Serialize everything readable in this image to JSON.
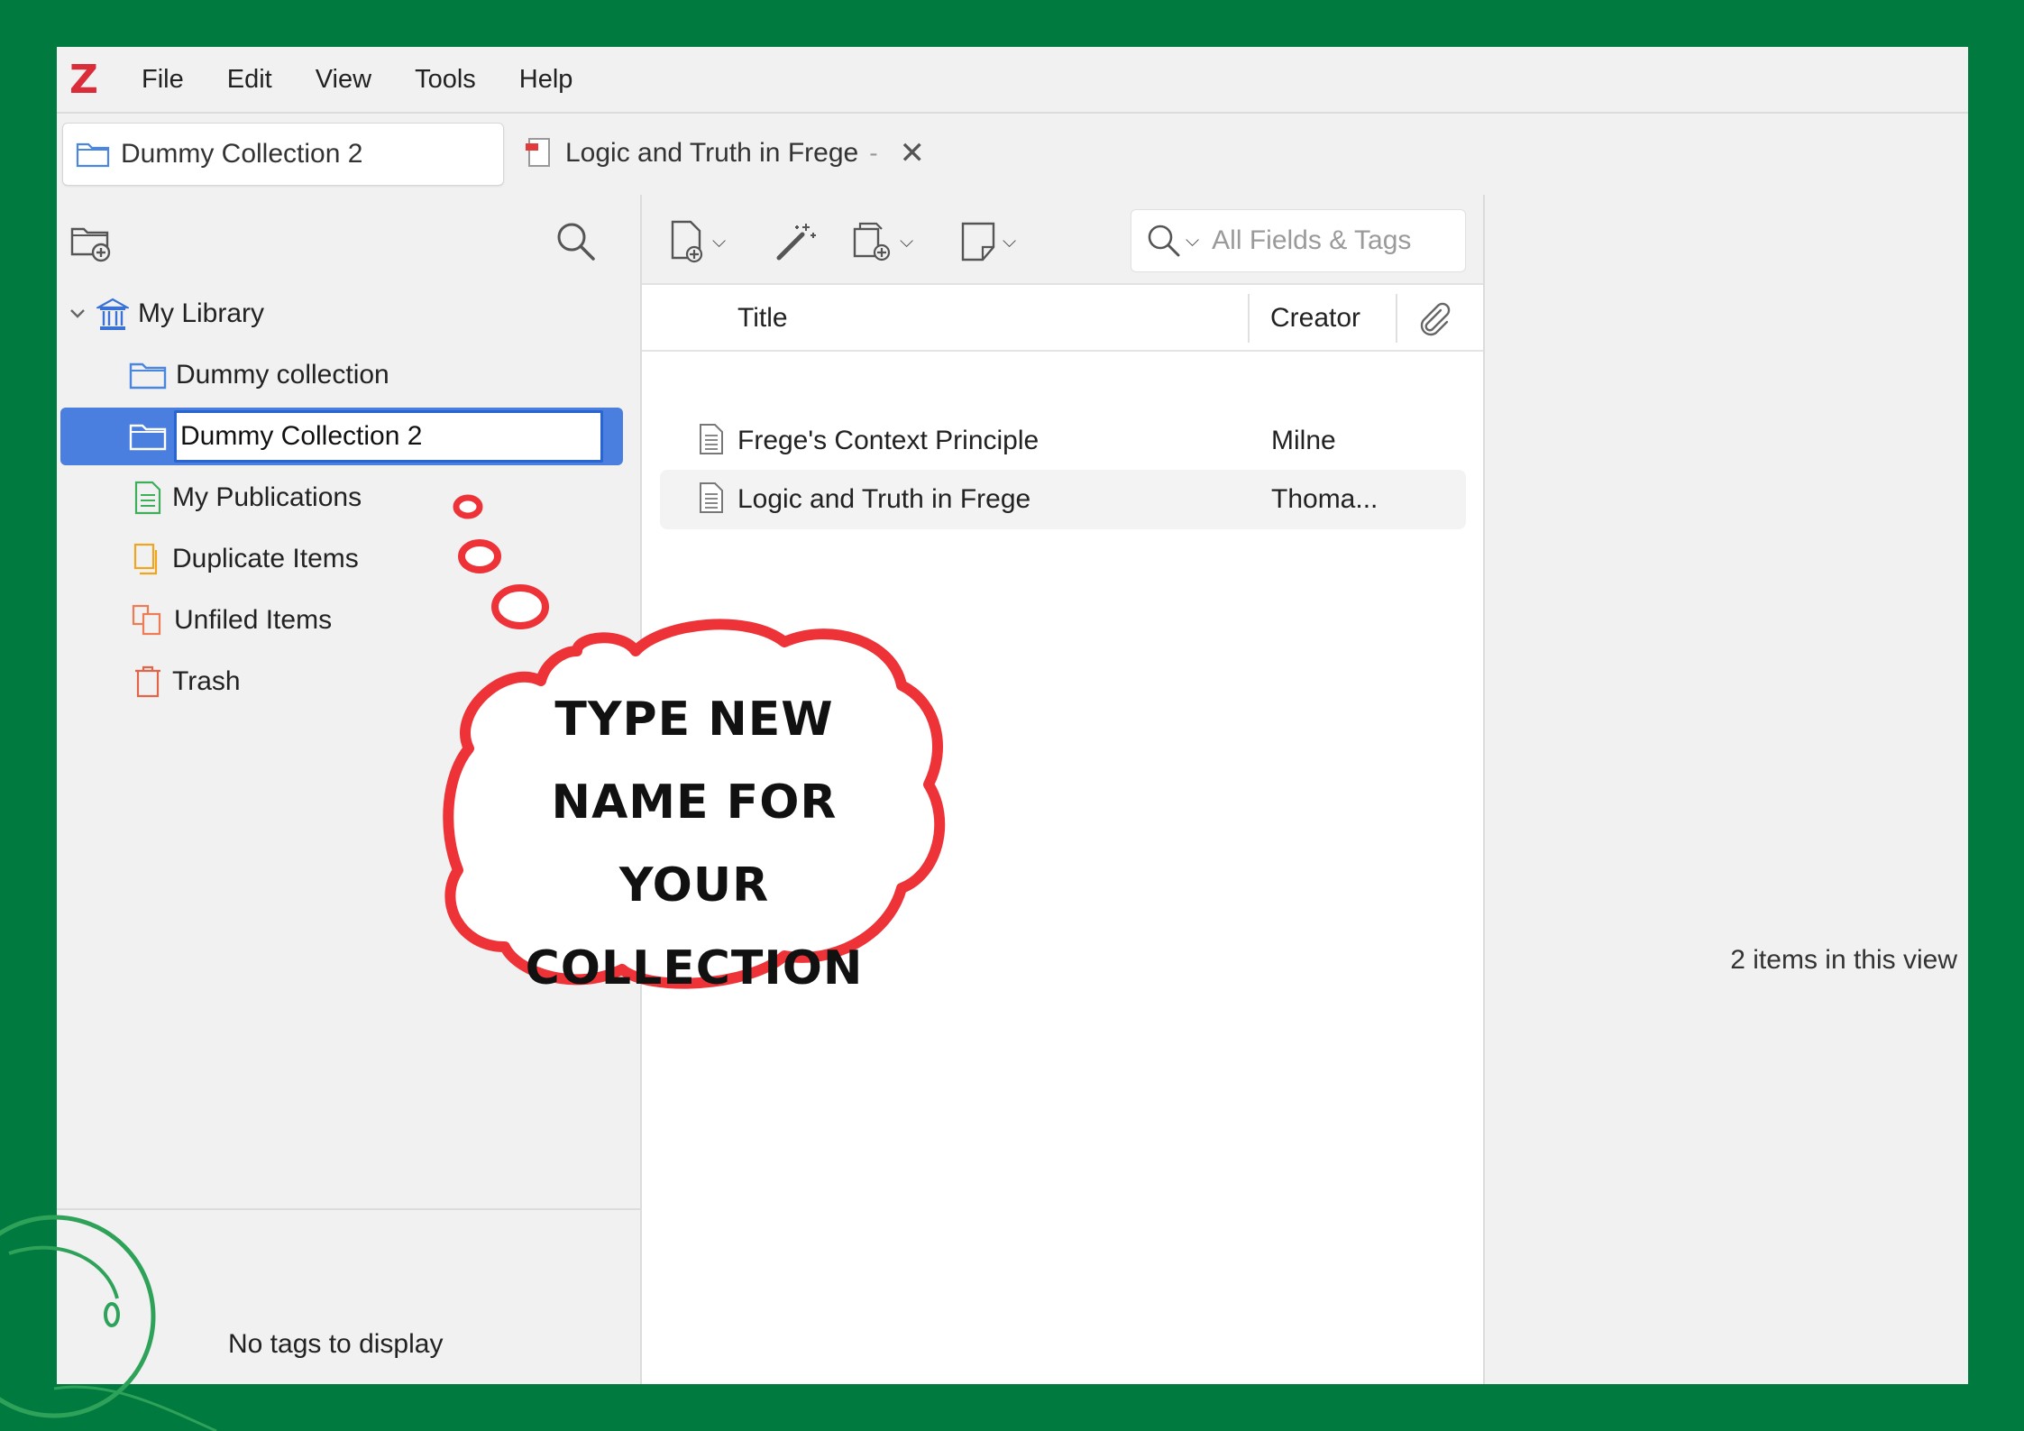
{
  "app": {
    "logo_letter": "Z"
  },
  "menubar": {
    "items": [
      "File",
      "Edit",
      "View",
      "Tools",
      "Help"
    ]
  },
  "tabs": {
    "active": {
      "label": "Dummy Collection 2"
    },
    "reader": {
      "label": "Logic and Truth in Frege",
      "separator": "-",
      "close_glyph": "✕"
    }
  },
  "collections": {
    "library": {
      "label": "My Library"
    },
    "items": [
      {
        "label": "Dummy collection"
      },
      {
        "label": "Dummy Collection 2",
        "editing": true
      },
      {
        "label": "My Publications"
      },
      {
        "label": "Duplicate Items"
      },
      {
        "label": "Unfiled Items"
      },
      {
        "label": "Trash"
      }
    ]
  },
  "tags_pane": {
    "empty_text": "No tags to display"
  },
  "search": {
    "placeholder": "All Fields & Tags"
  },
  "items_table": {
    "columns": {
      "title": "Title",
      "creator": "Creator"
    },
    "rows": [
      {
        "title": "Frege's Context Principle",
        "creator": "Milne"
      },
      {
        "title": "Logic and Truth in Frege",
        "creator": "Thoma..."
      }
    ]
  },
  "item_pane": {
    "count_text": "2 items in this view"
  },
  "annotation": {
    "lines": [
      "TYPE NEW",
      "NAME FOR YOUR",
      "COLLECTION"
    ]
  },
  "colors": {
    "background": "#017a3f",
    "selection": "#4a7fdf",
    "annotation_stroke": "#ee3338",
    "logo": "#db2c3a"
  }
}
